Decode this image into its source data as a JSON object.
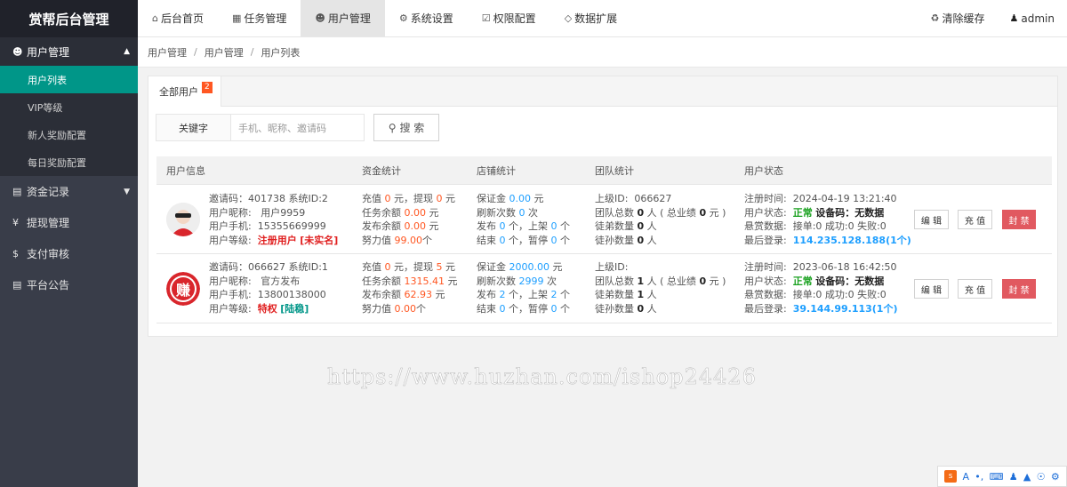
{
  "app": {
    "title": "赏帮后台管理"
  },
  "sidebar": {
    "group": {
      "label": "用户管理"
    },
    "subitems": [
      "用户列表",
      "VIP等级",
      "新人奖励配置",
      "每日奖励配置"
    ],
    "items": [
      "资金记录",
      "提现管理",
      "支付审核",
      "平台公告"
    ]
  },
  "topnav": {
    "items": [
      "后台首页",
      "任务管理",
      "用户管理",
      "系统设置",
      "权限配置",
      "数据扩展"
    ],
    "clear_cache": "清除缓存",
    "user": "admin"
  },
  "breadcrumb": [
    "用户管理",
    "用户管理",
    "用户列表"
  ],
  "tabs": [
    {
      "label": "全部用户",
      "badge": "2"
    }
  ],
  "search": {
    "label": "关键字",
    "placeholder": "手机、昵称、邀请码",
    "button": "搜 索"
  },
  "table": {
    "headers": [
      "用户信息",
      "资金统计",
      "店铺统计",
      "团队统计",
      "用户状态"
    ],
    "rows": [
      {
        "invite_code": "401738",
        "system_id": "2",
        "nickname": "用户9959",
        "phone": "15355669999",
        "level": "注册用户",
        "realname": "[未实名]",
        "recharge": "0",
        "withdraw": "0",
        "task_balance": "0.00",
        "publish_balance": "0.00",
        "effort": "99.00",
        "deposit": "0.00",
        "refresh": "0",
        "publish": "0",
        "listed": "0",
        "ended": "0",
        "paused": "0",
        "parent_id": "066627",
        "team_total": "0",
        "team_perf": "0",
        "disciples": "0",
        "grand_disciples": "0",
        "reg_time": "2024-04-19 13:21:40",
        "status": "正常",
        "device": "设备码：无数据",
        "bounty": "接单:0 成功:0 失败:0",
        "last_login": "114.235.128.188(1个)",
        "actions": [
          "编 辑",
          "充 值",
          "封 禁"
        ]
      },
      {
        "invite_code": "066627",
        "system_id": "1",
        "nickname": "官方发布",
        "phone": "13800138000",
        "level": "特权",
        "realname": "[陆稳]",
        "recharge": "0",
        "withdraw": "5",
        "task_balance": "1315.41",
        "publish_balance": "62.93",
        "effort": "0.00",
        "deposit": "2000.00",
        "refresh": "2999",
        "publish": "2",
        "listed": "2",
        "ended": "0",
        "paused": "0",
        "parent_id": "",
        "team_total": "1",
        "team_perf": "0",
        "disciples": "1",
        "grand_disciples": "0",
        "reg_time": "2023-06-18 16:42:50",
        "status": "正常",
        "device": "设备码：无数据",
        "bounty": "接单:0 成功:0 失败:0",
        "last_login": "39.144.99.113(1个)",
        "actions": [
          "编 辑",
          "充 值",
          "封 禁"
        ]
      }
    ]
  },
  "avatar2_char": "赚",
  "watermark": "https://www.huzhan.com/ishop24426",
  "tray": {
    "label": "A"
  },
  "colors": {
    "sidebar": "#393d49",
    "active": "#009688",
    "danger": "#e15960",
    "accent": "#ff5722",
    "link": "#1e9fff"
  }
}
